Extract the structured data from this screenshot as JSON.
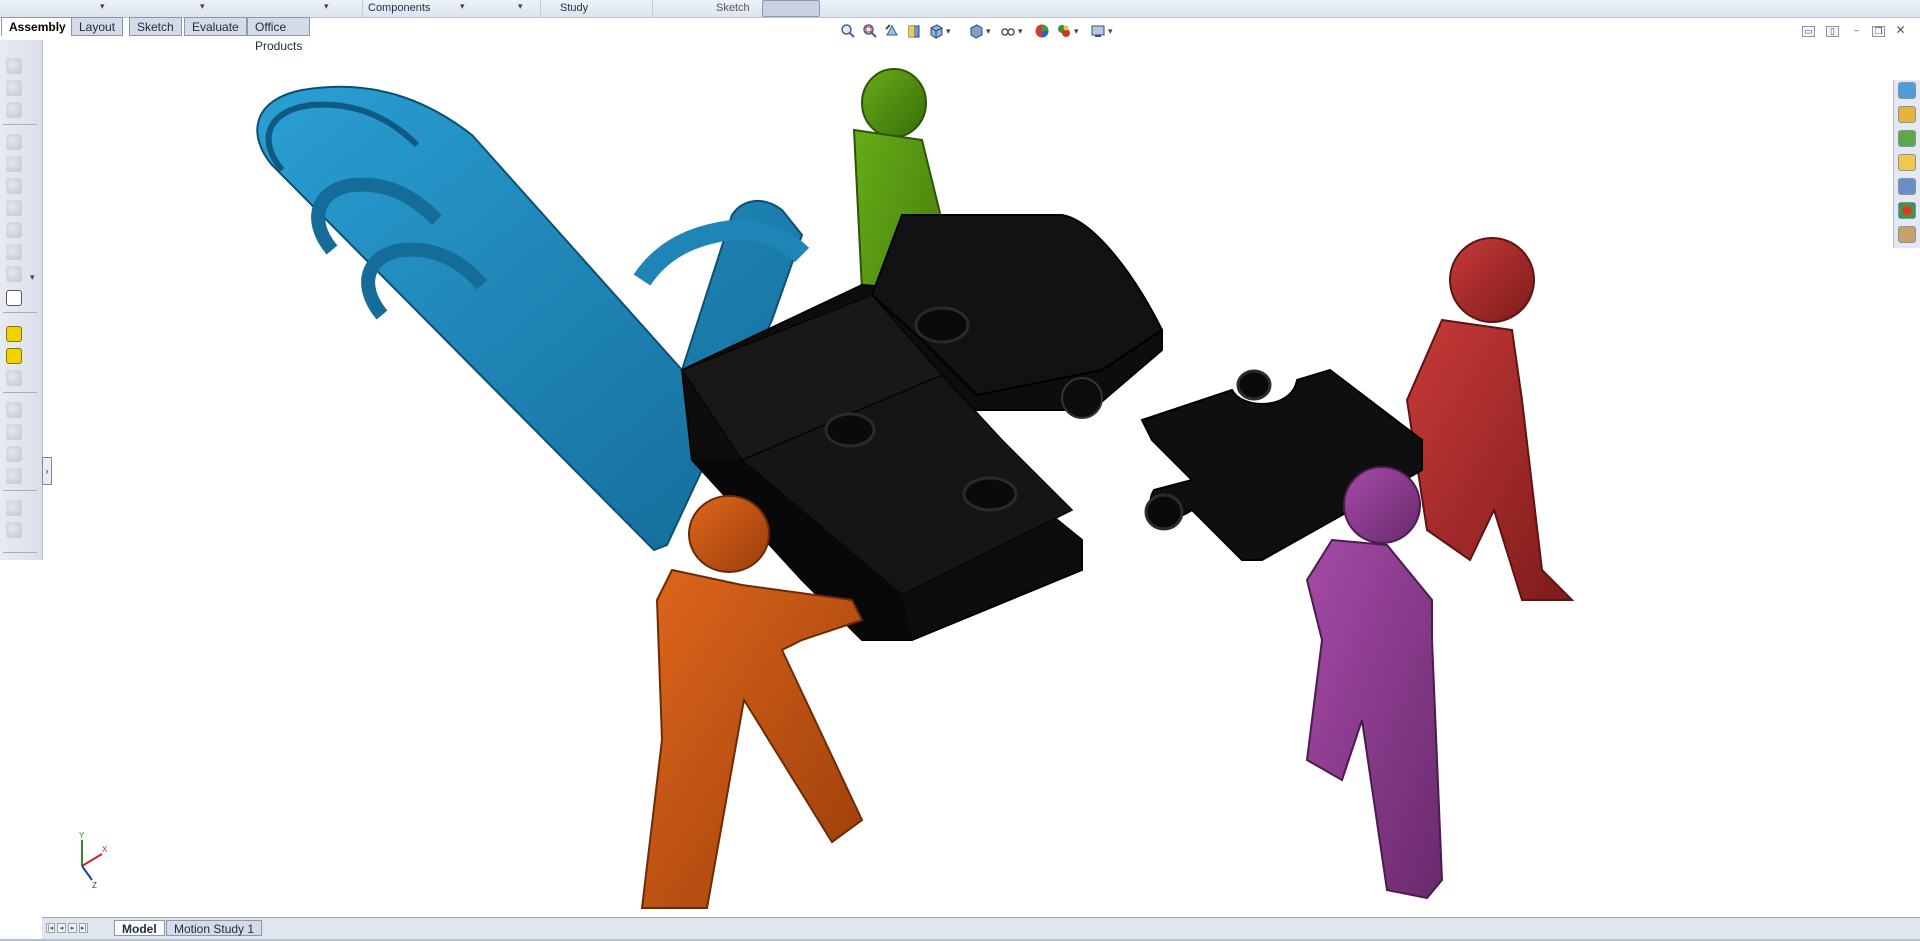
{
  "top_strip": {
    "items": [
      {
        "label": "Components"
      },
      {
        "label": "Study"
      },
      {
        "label": "Sketch"
      }
    ]
  },
  "command_tabs": [
    {
      "label": "Assembly",
      "active": true
    },
    {
      "label": "Layout",
      "active": false
    },
    {
      "label": "Sketch",
      "active": false
    },
    {
      "label": "Evaluate",
      "active": false
    },
    {
      "label": "Office Products",
      "active": false
    }
  ],
  "view_toolbar": {
    "icons": [
      "zoom-to-fit-icon",
      "zoom-to-area-icon",
      "previous-view-icon",
      "section-view-icon",
      "view-orientation-icon",
      "display-style-icon",
      "hide-show-items-icon",
      "edit-appearance-icon",
      "apply-scene-icon",
      "view-settings-icon"
    ]
  },
  "left_toolbar": {
    "icons": [
      "insert-components-icon",
      "mate-icon",
      "linear-pattern-icon",
      "smart-fasteners-icon",
      "move-component-icon",
      "show-hidden-icon",
      "assembly-features-icon",
      "reference-geometry-icon",
      "new-motion-study-icon",
      "bill-of-materials-icon",
      "exploded-view-icon",
      "explode-line-sketch-icon",
      "interference-detection-icon",
      "clearance-verification-icon",
      "hole-alignment-icon",
      "measure-icon",
      "mass-properties-icon",
      "section-properties-icon",
      "check-icon",
      "instant3d-icon"
    ]
  },
  "task_pane": {
    "icons": [
      "solidworks-resources-icon",
      "design-library-icon",
      "file-explorer-icon",
      "view-palette-icon",
      "appearances-icon",
      "custom-properties-icon",
      "forum-icon"
    ]
  },
  "bottom_tabs": [
    {
      "label": "Model",
      "active": true
    },
    {
      "label": "Motion Study 1",
      "active": false
    }
  ],
  "triad": {
    "x_label": "X",
    "y_label": "Y",
    "z_label": "Z"
  },
  "colors": {
    "blue_part": "#1b86b8",
    "green_part": "#4f8e0e",
    "red_part": "#a82a2a",
    "orange_part": "#c65312",
    "purple_part": "#8b3a8e",
    "puzzle_part": "#121212"
  }
}
